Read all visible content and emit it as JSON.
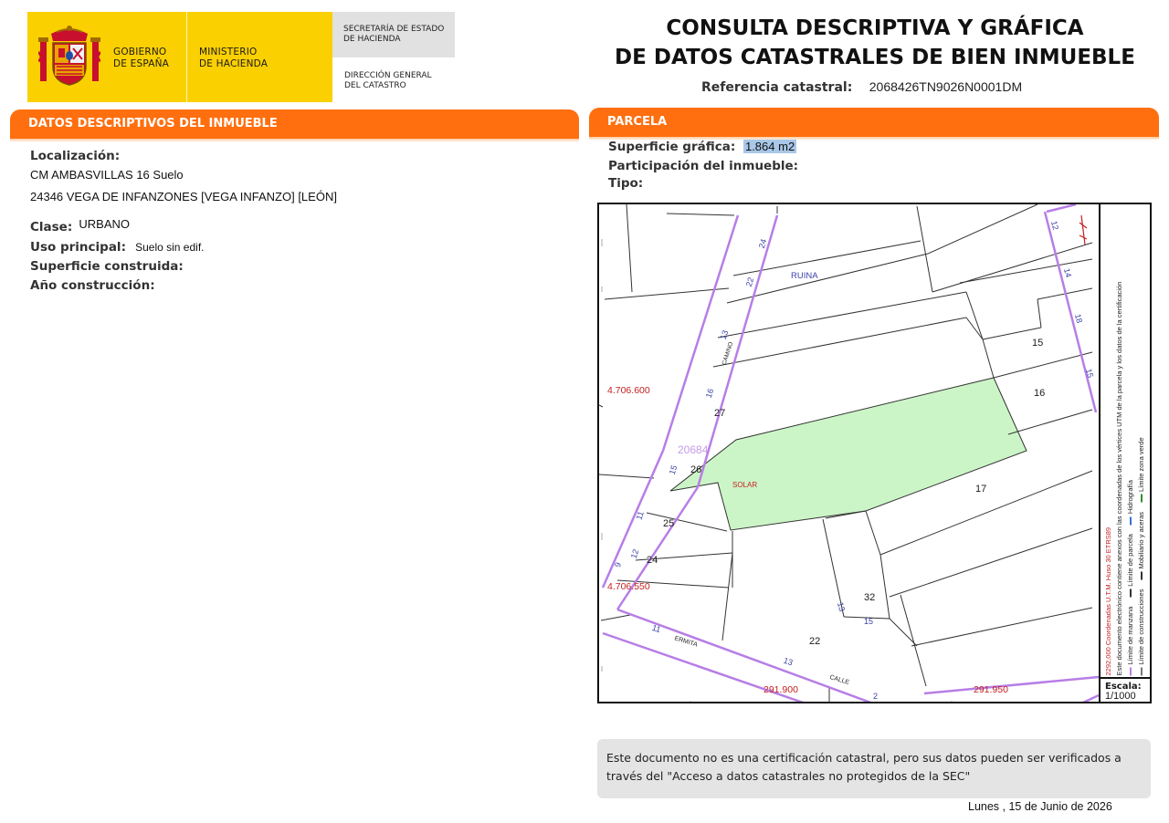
{
  "logo": {
    "gobierno": [
      "GOBIERNO",
      "DE ESPAÑA"
    ],
    "ministerio": [
      "MINISTERIO",
      "DE HACIENDA"
    ],
    "secretaria": [
      "SECRETARÍA DE ESTADO",
      "DE HACIENDA"
    ],
    "direccion": [
      "DIRECCIÓN GENERAL",
      "DEL CATASTRO"
    ]
  },
  "title": {
    "line1": "CONSULTA DESCRIPTIVA Y GRÁFICA",
    "line2": "DE DATOS CATASTRALES DE BIEN INMUEBLE"
  },
  "reference": {
    "label": "Referencia catastral:",
    "value": "2068426TN9026N0001DM"
  },
  "sections": {
    "descriptive": "DATOS DESCRIPTIVOS DEL INMUEBLE",
    "parcel": "PARCELA"
  },
  "descriptive": {
    "localizacion_label": "Localización:",
    "address_line1": "CM AMBASVILLAS 16 Suelo",
    "address_line2": "24346 VEGA DE INFANZONES [VEGA INFANZO] [LEÓN]",
    "clase_label": "Clase:",
    "clase_value": "URBANO",
    "uso_label": "Uso principal:",
    "uso_value": "Suelo sin edif.",
    "superficie_label": "Superficie construida:",
    "anio_label": "Año construcción:"
  },
  "parcel": {
    "superficie_label": "Superficie gráfica:",
    "superficie_value": "1.864 m2",
    "participacion_label": "Participación del inmueble:",
    "tipo_label": "Tipo:"
  },
  "map": {
    "coords": {
      "y_top": "4.706.600",
      "y_bottom": "4.706.550",
      "x_left": "291.900",
      "x_right": "291.950"
    },
    "parcel_ref": "20684",
    "parcel_label": "SOLAR",
    "ruina_label": "RUINA",
    "street_ermita": "ERMITA",
    "street_calle": "CALLE",
    "street_camino": "CAMINO",
    "lot_numbers": {
      "n15": "15",
      "n16": "16",
      "n17": "17",
      "n22": "22",
      "n24": "24",
      "n25": "25",
      "n26": "26",
      "n27": "27",
      "n32": "32"
    },
    "street_numbers": [
      "12",
      "14",
      "18",
      "15",
      "24",
      "22",
      "13",
      "16",
      "15",
      "11",
      "12",
      "9",
      "11",
      "13",
      "15",
      "13",
      "2"
    ],
    "legend": {
      "left_line1": "2292,000 Coordenadas U.T.M. Huso 30 ETRS89",
      "left_line2": "Este documento electrónico contiene anexos con las coordenadas de los vértices UTM de la parcela y los datos de la certificación",
      "items": [
        "Límite de manzana",
        "Límite de parcela",
        "Hidrografía",
        "Límite de construcciones",
        "Mobiliario y aceras",
        "Límite zona verde"
      ]
    },
    "scale_label": "Escala:",
    "scale_value": "1/1000"
  },
  "notice": {
    "text": "Este documento no es una certificación catastral, pero sus datos pueden ser verificados a través del \"Acceso a datos catastrales no protegidos de la SEC\""
  },
  "date": "Lunes , 15 de Junio de 2026",
  "colors": {
    "orange": "#ff6f0f",
    "logo_yellow": "#fbd000",
    "parcel_green": "#ccf5c7",
    "street_purple": "#b77ee6",
    "coord_red": "#c41f1f"
  }
}
